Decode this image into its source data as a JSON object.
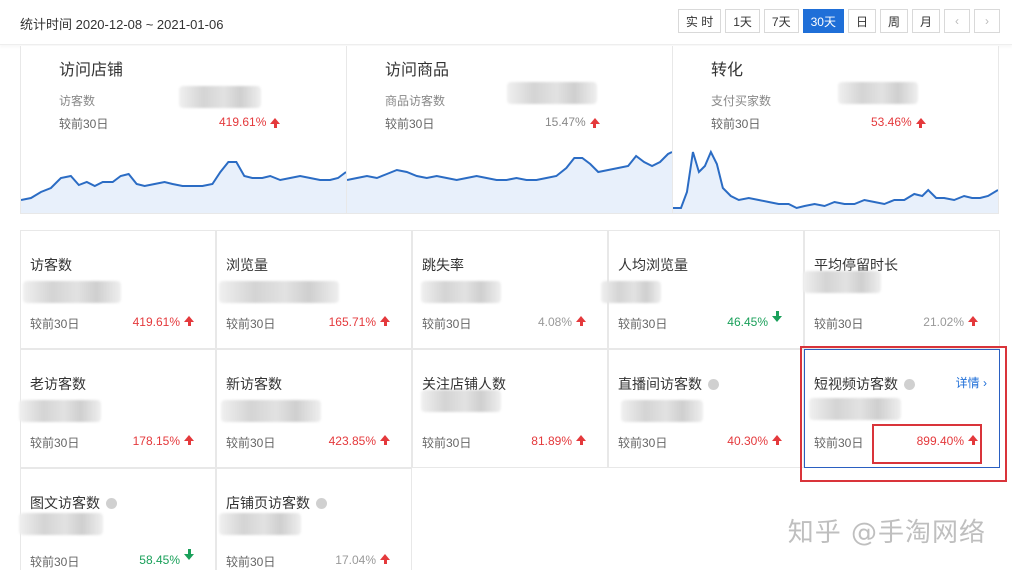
{
  "header": {
    "range_label": "统计时间 2020-12-08 ~ 2021-01-06",
    "buttons": [
      "实 时",
      "1天",
      "7天",
      "30天",
      "日",
      "周",
      "月"
    ],
    "active_button": "30天",
    "prev_icon": "chevron-left-icon",
    "next_icon": "chevron-right-icon"
  },
  "overview": [
    {
      "title": "访问店铺",
      "sub": "访客数",
      "compare": "较前30日",
      "pct": "419.61%",
      "trend": "up"
    },
    {
      "title": "访问商品",
      "sub": "商品访客数",
      "compare": "较前30日",
      "pct": "15.47%",
      "trend": "up"
    },
    {
      "title": "转化",
      "sub": "支付买家数",
      "compare": "较前30日",
      "pct": "53.46%",
      "trend": "up"
    }
  ],
  "metrics": [
    {
      "title": "访客数",
      "compare": "较前30日",
      "pct": "419.61%",
      "trend": "up",
      "tone": "up",
      "help": false
    },
    {
      "title": "浏览量",
      "compare": "较前30日",
      "pct": "165.71%",
      "trend": "up",
      "tone": "up",
      "help": false
    },
    {
      "title": "跳失率",
      "compare": "较前30日",
      "pct": "4.08%",
      "trend": "up",
      "tone": "gray",
      "help": false
    },
    {
      "title": "人均浏览量",
      "compare": "较前30日",
      "pct": "46.45%",
      "trend": "down",
      "tone": "down",
      "help": false
    },
    {
      "title": "平均停留时长",
      "compare": "较前30日",
      "pct": "21.02%",
      "trend": "up",
      "tone": "gray",
      "help": false
    },
    {
      "title": "老访客数",
      "compare": "较前30日",
      "pct": "178.15%",
      "trend": "up",
      "tone": "up",
      "help": false
    },
    {
      "title": "新访客数",
      "compare": "较前30日",
      "pct": "423.85%",
      "trend": "up",
      "tone": "up",
      "help": false
    },
    {
      "title": "关注店铺人数",
      "compare": "较前30日",
      "pct": "81.89%",
      "trend": "up",
      "tone": "up",
      "help": false
    },
    {
      "title": "直播间访客数",
      "compare": "较前30日",
      "pct": "40.30%",
      "trend": "up",
      "tone": "up",
      "help": true
    },
    {
      "title": "短视频访客数",
      "compare": "较前30日",
      "pct": "899.40%",
      "trend": "up",
      "tone": "up",
      "help": true,
      "detail": "详情"
    },
    {
      "title": "图文访客数",
      "compare": "较前30日",
      "pct": "58.45%",
      "trend": "down",
      "tone": "down",
      "help": true
    },
    {
      "title": "店铺页访客数",
      "compare": "较前30日",
      "pct": "17.04%",
      "trend": "up",
      "tone": "gray",
      "help": true
    }
  ],
  "watermark": "知乎 @手淘网络",
  "colors": {
    "accent": "#1f6fd8",
    "up": "#e4393c",
    "down": "#1aa05a",
    "highlight": "#d9343a",
    "line": "#2b6cc4",
    "fill": "#e8f0fb"
  }
}
